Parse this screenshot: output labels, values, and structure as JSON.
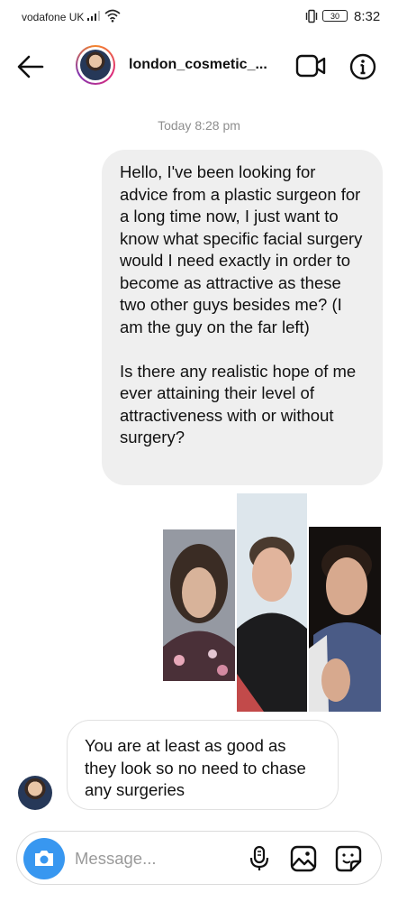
{
  "status_bar": {
    "carrier": "vodafone UK",
    "battery": "30",
    "time": "8:32"
  },
  "header": {
    "username": "london_cosmetic_...",
    "icons": [
      "back-arrow-icon",
      "video-camera-icon",
      "info-icon"
    ]
  },
  "chat": {
    "timestamp": "Today 8:28 pm",
    "outgoing": {
      "paragraphs": [
        "Hello, I've been looking for advice from a plastic surgeon for a long time now, I just want to know what specific facial surgery would I need exactly in order to become as attractive as these two other guys besides me? (I am the guy on the far left)",
        "Is there any realistic hope of me ever attaining their level of attractiveness with or without surgery?"
      ]
    },
    "photos": [
      "photo-1",
      "photo-2",
      "photo-3"
    ],
    "incoming": {
      "text": "You are at least as good as they look so no need to chase any surgeries"
    }
  },
  "composer": {
    "placeholder": "Message..."
  },
  "colors": {
    "accent": "#3897f0",
    "bubble_out": "#efefef",
    "muted": "#8e8e8e"
  }
}
